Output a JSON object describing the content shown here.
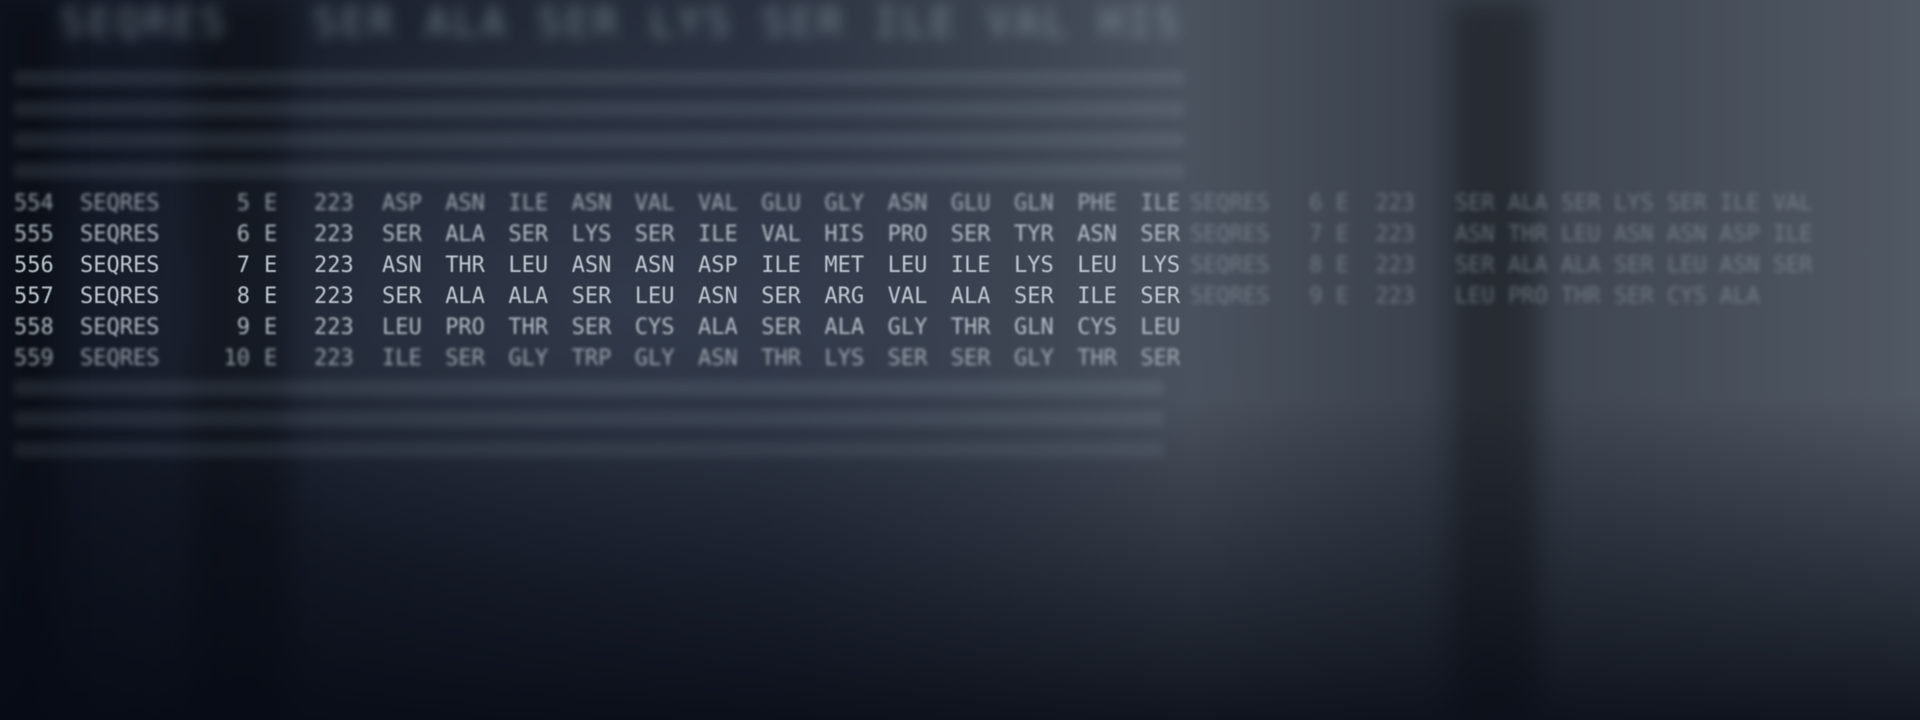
{
  "record_label": "SEQRES",
  "chain": "E",
  "residue_count": "223",
  "header_blur": "SEQRES   SER ALA SER LYS SER ILE VAL HIS",
  "rows": [
    {
      "line": "554",
      "serial": "5",
      "residues": [
        "ASP",
        "ASN",
        "ILE",
        "ASN",
        "VAL",
        "VAL",
        "GLU",
        "GLY",
        "ASN",
        "GLU",
        "GLN",
        "PHE",
        "ILE"
      ]
    },
    {
      "line": "555",
      "serial": "6",
      "residues": [
        "SER",
        "ALA",
        "SER",
        "LYS",
        "SER",
        "ILE",
        "VAL",
        "HIS",
        "PRO",
        "SER",
        "TYR",
        "ASN",
        "SER"
      ]
    },
    {
      "line": "556",
      "serial": "7",
      "residues": [
        "ASN",
        "THR",
        "LEU",
        "ASN",
        "ASN",
        "ASP",
        "ILE",
        "MET",
        "LEU",
        "ILE",
        "LYS",
        "LEU",
        "LYS"
      ]
    },
    {
      "line": "557",
      "serial": "8",
      "residues": [
        "SER",
        "ALA",
        "ALA",
        "SER",
        "LEU",
        "ASN",
        "SER",
        "ARG",
        "VAL",
        "ALA",
        "SER",
        "ILE",
        "SER"
      ]
    },
    {
      "line": "558",
      "serial": "9",
      "residues": [
        "LEU",
        "PRO",
        "THR",
        "SER",
        "CYS",
        "ALA",
        "SER",
        "ALA",
        "GLY",
        "THR",
        "GLN",
        "CYS",
        "LEU"
      ]
    },
    {
      "line": "559",
      "serial": "10",
      "residues": [
        "ILE",
        "SER",
        "GLY",
        "TRP",
        "GLY",
        "ASN",
        "THR",
        "LYS",
        "SER",
        "SER",
        "GLY",
        "THR",
        "SER"
      ]
    }
  ],
  "ghost_rows": [
    "SEQRES   6 E  223   SER ALA SER LYS SER ILE VAL",
    "SEQRES   7 E  223   ASN THR LEU ASN ASN ASP ILE",
    "SEQRES   8 E  223   SER ALA ALA SER LEU ASN SER",
    "SEQRES   9 E  223   LEU PRO THR SER CYS ALA"
  ]
}
